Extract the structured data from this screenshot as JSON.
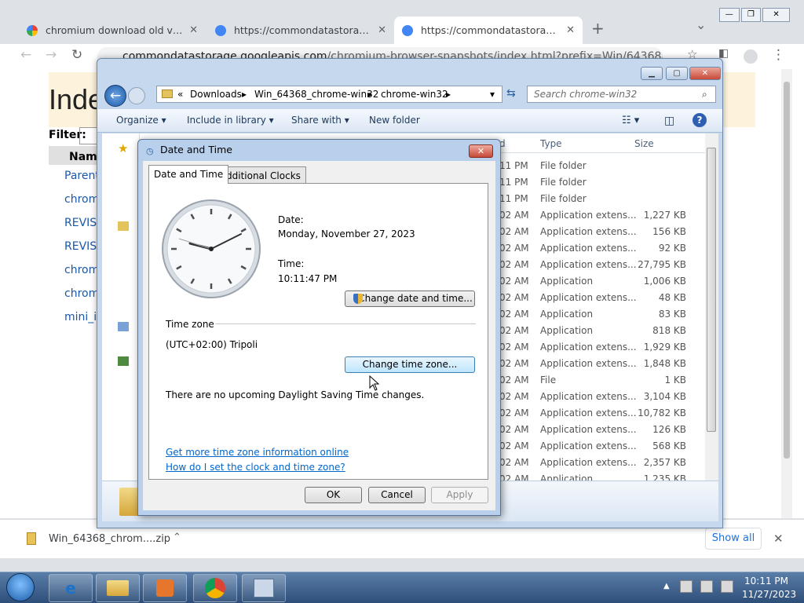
{
  "chrome": {
    "tabs": [
      {
        "title": "chromium download old version",
        "close": "✕"
      },
      {
        "title": "https://commondatastorage.goo",
        "close": "✕"
      },
      {
        "title": "https://commondatastorage.goo",
        "close": "✕"
      }
    ],
    "new_tab": "+",
    "tab_search": "⌄",
    "win_minimize": "—",
    "win_restore": "❐",
    "win_close": "✕",
    "url_host": "commondatastorage.googleapis.com",
    "url_path": "/chromium-browser-snapshots/index.html?prefix=Win/64368/"
  },
  "webpage": {
    "heading": "Inde",
    "filter_label": "Filter:",
    "name_header": "Name",
    "items": [
      "Parent",
      "chrom",
      "REVIS",
      "REVIS",
      "chrom",
      "chrom",
      "mini_i"
    ]
  },
  "downloads": {
    "file": "Win_64368_chrom....zip",
    "show_all": "Show all",
    "close": "✕"
  },
  "explorer": {
    "breadcrumb": [
      "«",
      "Downloads",
      "Win_64368_chrome-win32",
      "chrome-win32"
    ],
    "search_placeholder": "Search chrome-win32",
    "commands": [
      "Organize",
      "Include in library",
      "Share with",
      "New folder"
    ],
    "columns": {
      "modified": "d",
      "type": "Type",
      "size": "Size"
    },
    "rows": [
      {
        "time": "11 PM",
        "type": "File folder",
        "size": ""
      },
      {
        "time": "11 PM",
        "type": "File folder",
        "size": ""
      },
      {
        "time": "11 PM",
        "type": "File folder",
        "size": ""
      },
      {
        "time": "02 AM",
        "type": "Application extens...",
        "size": "1,227 KB"
      },
      {
        "time": "02 AM",
        "type": "Application extens...",
        "size": "156 KB"
      },
      {
        "time": "02 AM",
        "type": "Application extens...",
        "size": "92 KB"
      },
      {
        "time": "02 AM",
        "type": "Application extens...",
        "size": "27,795 KB"
      },
      {
        "time": "02 AM",
        "type": "Application",
        "size": "1,006 KB"
      },
      {
        "time": "02 AM",
        "type": "Application extens...",
        "size": "48 KB"
      },
      {
        "time": "02 AM",
        "type": "Application",
        "size": "83 KB"
      },
      {
        "time": "02 AM",
        "type": "Application",
        "size": "818 KB"
      },
      {
        "time": "02 AM",
        "type": "Application extens...",
        "size": "1,929 KB"
      },
      {
        "time": "02 AM",
        "type": "Application extens...",
        "size": "1,848 KB"
      },
      {
        "time": "02 AM",
        "type": "File",
        "size": "1 KB"
      },
      {
        "time": "02 AM",
        "type": "Application extens...",
        "size": "3,104 KB"
      },
      {
        "time": "02 AM",
        "type": "Application extens...",
        "size": "10,782 KB"
      },
      {
        "time": "02 AM",
        "type": "Application extens...",
        "size": "126 KB"
      },
      {
        "time": "02 AM",
        "type": "Application extens...",
        "size": "568 KB"
      },
      {
        "time": "02 AM",
        "type": "Application extens...",
        "size": "2,357 KB"
      },
      {
        "time": "02 AM",
        "type": "Application",
        "size": "1,235 KB"
      }
    ]
  },
  "dialog": {
    "title": "Date and Time",
    "tabs": [
      "Date and Time",
      "Additional Clocks"
    ],
    "date_label": "Date:",
    "date_value": "Monday, November 27, 2023",
    "time_label": "Time:",
    "time_value": "10:11:47 PM",
    "change_datetime": "Change date and time...",
    "timezone_label": "Time zone",
    "timezone_value": "(UTC+02:00) Tripoli",
    "change_timezone": "Change time zone...",
    "dst_note": "There are no upcoming Daylight Saving Time changes.",
    "link_info": "Get more time zone information online",
    "link_help": "How do I set the clock and time zone?",
    "ok": "OK",
    "cancel": "Cancel",
    "apply": "Apply"
  },
  "taskbar": {
    "clock_time": "10:11 PM",
    "clock_date": "11/27/2023"
  }
}
